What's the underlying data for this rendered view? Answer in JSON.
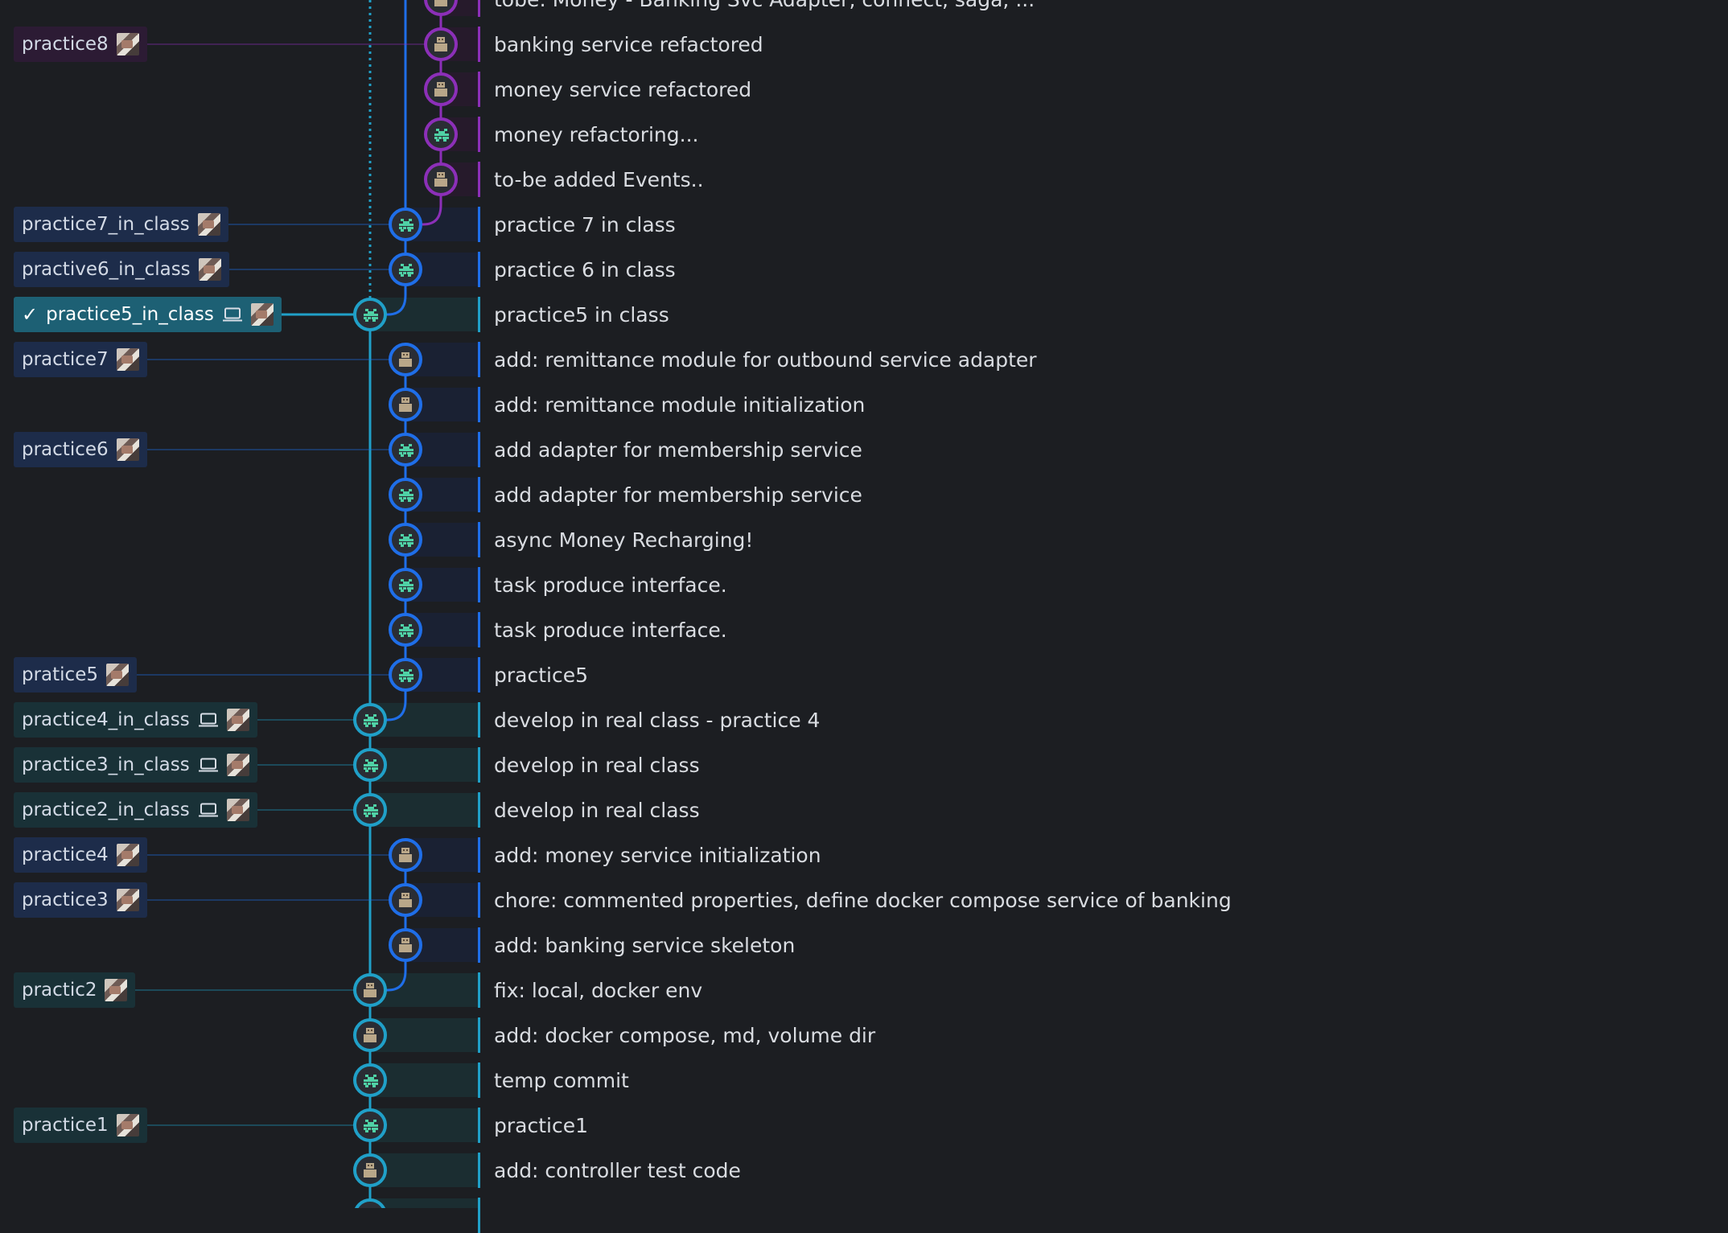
{
  "colors": {
    "main_lane": "#20a0c8",
    "blue_lane": "#1f6ee8",
    "purple_lane": "#8c2fb8",
    "avatar_green": "#4fd1a5",
    "avatar_tan": "#b9a789"
  },
  "branches": [
    {
      "label": "practice8",
      "row": 1,
      "style": "purple",
      "lane": "purple",
      "icons": [
        "avatar"
      ]
    },
    {
      "label": "practice7_in_class",
      "row": 5,
      "style": "blue",
      "lane": "blue",
      "icons": [
        "avatar"
      ]
    },
    {
      "label": "practive6_in_class",
      "row": 6,
      "style": "blue",
      "lane": "blue",
      "icons": [
        "avatar"
      ]
    },
    {
      "label": "practice5_in_class",
      "row": 7,
      "style": "active",
      "lane": "main",
      "checked": true,
      "icons": [
        "laptop",
        "avatar"
      ]
    },
    {
      "label": "practice7",
      "row": 8,
      "style": "blue",
      "lane": "blue",
      "icons": [
        "avatar"
      ]
    },
    {
      "label": "practice6",
      "row": 10,
      "style": "blue",
      "lane": "blue",
      "icons": [
        "avatar"
      ]
    },
    {
      "label": "pratice5",
      "row": 15,
      "style": "blue",
      "lane": "blue",
      "icons": [
        "avatar"
      ]
    },
    {
      "label": "practice4_in_class",
      "row": 16,
      "style": "teal",
      "lane": "main",
      "icons": [
        "laptop",
        "avatar"
      ]
    },
    {
      "label": "practice3_in_class",
      "row": 17,
      "style": "teal",
      "lane": "main",
      "icons": [
        "laptop",
        "avatar"
      ]
    },
    {
      "label": "practice2_in_class",
      "row": 18,
      "style": "teal",
      "lane": "main",
      "icons": [
        "laptop",
        "avatar"
      ]
    },
    {
      "label": "practice4",
      "row": 19,
      "style": "blue",
      "lane": "blue",
      "icons": [
        "avatar"
      ]
    },
    {
      "label": "practice3",
      "row": 20,
      "style": "blue",
      "lane": "blue",
      "icons": [
        "avatar"
      ]
    },
    {
      "label": "practic2",
      "row": 22,
      "style": "teal",
      "lane": "main",
      "icons": [
        "avatar"
      ]
    },
    {
      "label": "practice1",
      "row": 25,
      "style": "teal",
      "lane": "main",
      "icons": [
        "avatar"
      ]
    }
  ],
  "commits": [
    {
      "message": "tobe: Money - Banking Svc Adapter, connect, saga, ...",
      "lane": "purple",
      "avatar": "tan"
    },
    {
      "message": "banking service refactored",
      "lane": "purple",
      "avatar": "tan"
    },
    {
      "message": "money service refactored",
      "lane": "purple",
      "avatar": "tan"
    },
    {
      "message": "money refactoring...",
      "lane": "purple",
      "avatar": "green"
    },
    {
      "message": "to-be added Events..",
      "lane": "purple",
      "avatar": "tan"
    },
    {
      "message": "practice 7 in class",
      "lane": "blue",
      "avatar": "green"
    },
    {
      "message": "practice 6 in class",
      "lane": "blue",
      "avatar": "green"
    },
    {
      "message": "practice5 in class",
      "lane": "main",
      "avatar": "green"
    },
    {
      "message": "add: remittance module for outbound service adapter",
      "lane": "blue",
      "avatar": "tan"
    },
    {
      "message": "add: remittance module initialization",
      "lane": "blue",
      "avatar": "tan"
    },
    {
      "message": "add adapter for membership service",
      "lane": "blue",
      "avatar": "green"
    },
    {
      "message": "add adapter for membership service",
      "lane": "blue",
      "avatar": "green"
    },
    {
      "message": "async Money Recharging!",
      "lane": "blue",
      "avatar": "green"
    },
    {
      "message": "task produce interface.",
      "lane": "blue",
      "avatar": "green"
    },
    {
      "message": "task produce interface.",
      "lane": "blue",
      "avatar": "green"
    },
    {
      "message": "practice5",
      "lane": "blue",
      "avatar": "green"
    },
    {
      "message": "develop in real class - practice 4",
      "lane": "main",
      "avatar": "green"
    },
    {
      "message": "develop in real class",
      "lane": "main",
      "avatar": "green"
    },
    {
      "message": "develop in real class",
      "lane": "main",
      "avatar": "green"
    },
    {
      "message": "add: money service initialization",
      "lane": "blue",
      "avatar": "tan"
    },
    {
      "message": "chore: commented properties, define docker compose service of banking",
      "lane": "blue",
      "avatar": "tan"
    },
    {
      "message": "add: banking service skeleton",
      "lane": "blue",
      "avatar": "tan"
    },
    {
      "message": "fix: local, docker env",
      "lane": "main",
      "avatar": "tan"
    },
    {
      "message": "add: docker compose, md, volume dir",
      "lane": "main",
      "avatar": "tan"
    },
    {
      "message": "temp commit",
      "lane": "main",
      "avatar": "green"
    },
    {
      "message": "practice1",
      "lane": "main",
      "avatar": "green"
    },
    {
      "message": "add: controller test code",
      "lane": "main",
      "avatar": "tan"
    },
    {
      "message": "",
      "lane": "main",
      "avatar": "tan"
    }
  ]
}
